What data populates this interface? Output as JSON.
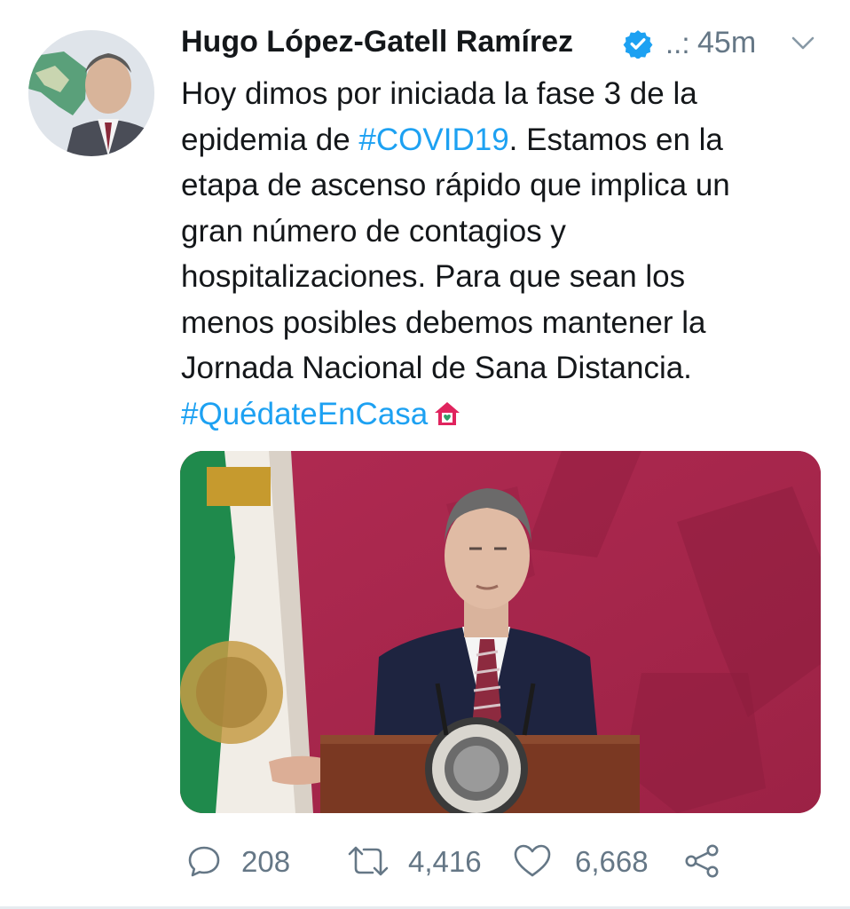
{
  "tweet": {
    "author": {
      "name": "Hugo López-Gatell Ramírez",
      "verified_icon": "verified-badge-icon",
      "handle": "..:",
      "avatar_icon": "avatar"
    },
    "time": "45m",
    "text": {
      "line1": "Hoy dimos por iniciada la fase 3 de la",
      "line2_before": "epidemia de ",
      "line2_hashtag": "#COVID19",
      "line2_after": ". Estamos en la",
      "line3": "etapa de ascenso rápido que implica un",
      "line4": "gran número de contagios y",
      "line5": "hospitalizaciones. Para que sean los",
      "line6": "menos posibles debemos mantener la",
      "line7": "Jornada Nacional de Sana Distancia.",
      "line8_hashtag": "#QuédateEnCasa",
      "emoji": "house-with-heart-icon"
    },
    "colors": {
      "hashtag": "#1da1f2",
      "muted": "#657786",
      "text": "#14171a",
      "photo_background": "#a4274a"
    },
    "actions": {
      "reply": {
        "icon": "reply-icon",
        "count": "208"
      },
      "retweet": {
        "icon": "retweet-icon",
        "count": "4,416"
      },
      "like": {
        "icon": "heart-icon",
        "count": "6,668"
      },
      "share": {
        "icon": "share-icon"
      }
    },
    "menu_icon": "chevron-down-icon"
  }
}
